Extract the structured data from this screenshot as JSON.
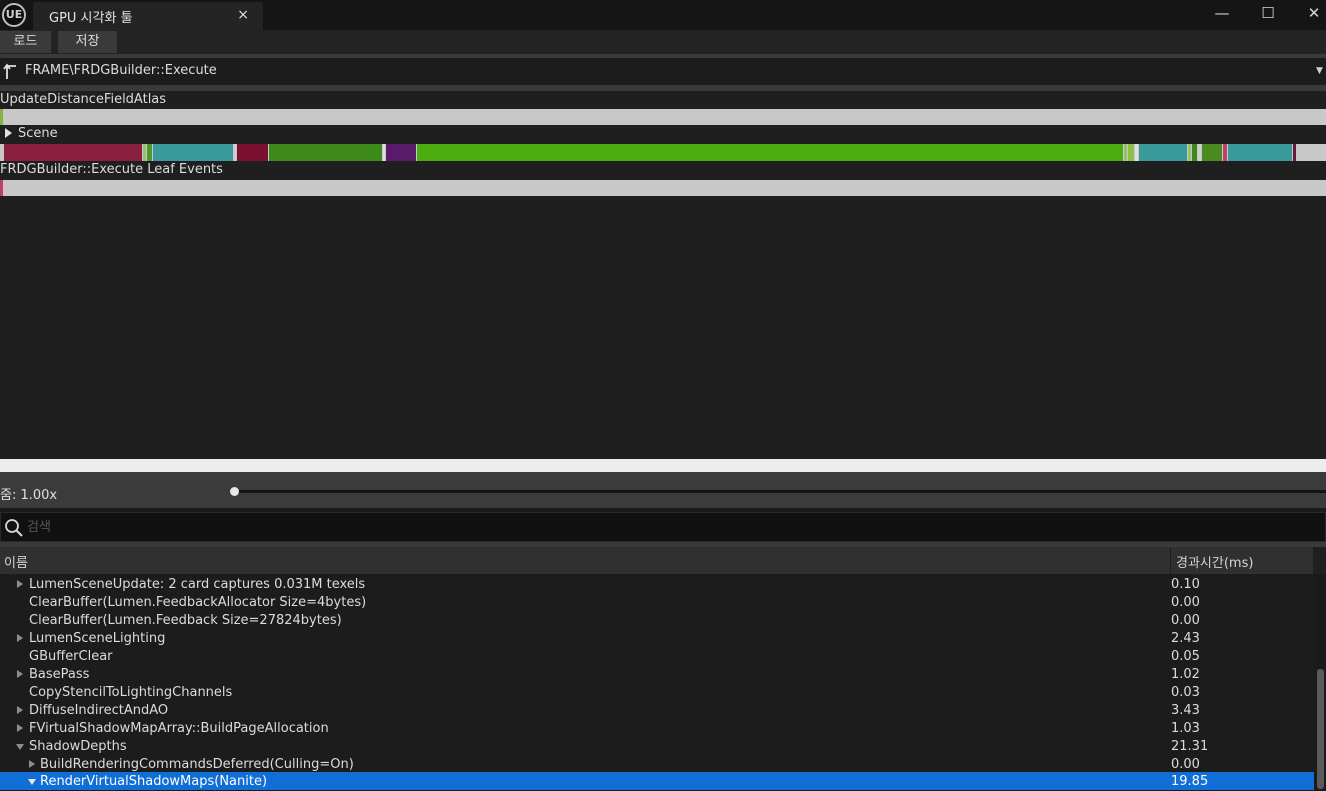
{
  "window": {
    "logo": "UE",
    "tab_title": "GPU 시각화 툴",
    "tab_close": "×",
    "minimize": "—",
    "maximize": "☐",
    "close": "✕"
  },
  "toolbar": {
    "load_label": "로드",
    "save_label": "저장"
  },
  "breadcrumb": {
    "path": "FRAME\\FRDGBuilder::Execute"
  },
  "timeline": {
    "rows": [
      {
        "label": "UpdateDistanceFieldAtlas",
        "marker_color": "#7fb83a"
      },
      {
        "label": "Scene"
      },
      {
        "label": "FRDGBuilder::Execute Leaf Events",
        "marker_color": "#c0406a"
      }
    ],
    "scene_segment_colors": [
      "#8a2040",
      "#3a9a9a",
      "#7a1030",
      "#3d8a1a",
      "#5a1a6a",
      "#4cac12",
      "#8ac04a"
    ]
  },
  "zoom": {
    "label": "줌: 1.00x"
  },
  "search": {
    "placeholder": "검색"
  },
  "table": {
    "col_name": "이름",
    "col_time": "경과시간(ms)",
    "rows": [
      {
        "name": "LumenSceneUpdate: 2 card captures 0.031M texels",
        "time": "0.10"
      },
      {
        "name": "ClearBuffer(Lumen.FeedbackAllocator Size=4bytes)",
        "time": "0.00"
      },
      {
        "name": "ClearBuffer(Lumen.Feedback Size=27824bytes)",
        "time": "0.00"
      },
      {
        "name": "LumenSceneLighting",
        "time": "2.43"
      },
      {
        "name": "GBufferClear",
        "time": "0.05"
      },
      {
        "name": "BasePass",
        "time": "1.02"
      },
      {
        "name": "CopyStencilToLightingChannels",
        "time": "0.03"
      },
      {
        "name": "DiffuseIndirectAndAO",
        "time": "3.43"
      },
      {
        "name": "FVirtualShadowMapArray::BuildPageAllocation",
        "time": "1.03"
      },
      {
        "name": "ShadowDepths",
        "time": "21.31"
      },
      {
        "name": "BuildRenderingCommandsDeferred(Culling=On)",
        "time": "0.00"
      },
      {
        "name": "RenderVirtualShadowMaps(Nanite)",
        "time": "19.85"
      }
    ]
  }
}
